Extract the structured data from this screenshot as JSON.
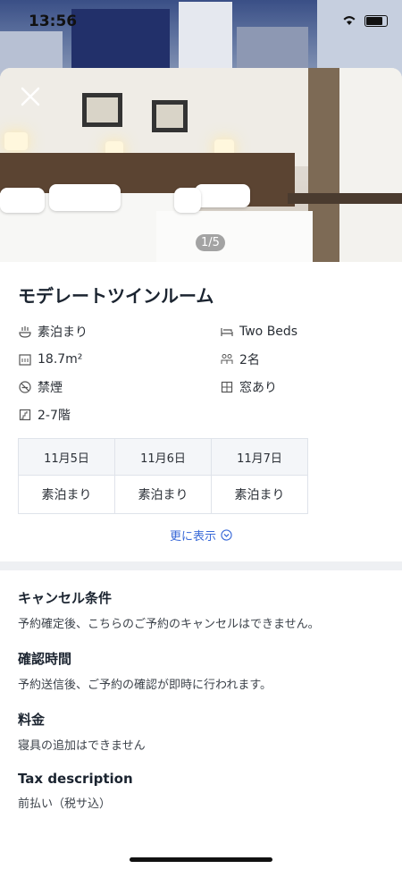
{
  "status_bar": {
    "time": "13:56"
  },
  "photo": {
    "counter": "1/5"
  },
  "room": {
    "title": "モデレートツインルーム",
    "amenities": [
      {
        "icon": "meal-icon",
        "label": "素泊まり"
      },
      {
        "icon": "bed-icon",
        "label": "Two Beds"
      },
      {
        "icon": "area-icon",
        "label": "18.7m²"
      },
      {
        "icon": "guests-icon",
        "label": "2名"
      },
      {
        "icon": "no-smoking-icon",
        "label": "禁煙"
      },
      {
        "icon": "window-icon",
        "label": "窓あり"
      },
      {
        "icon": "floor-icon",
        "label": "2-7階"
      }
    ]
  },
  "table": {
    "dates": [
      "11月5日",
      "11月6日",
      "11月7日"
    ],
    "plans": [
      "素泊まり",
      "素泊まり",
      "素泊まり"
    ]
  },
  "show_more": "更に表示",
  "policies": [
    {
      "title": "キャンセル条件",
      "text": "予約確定後、こちらのご予約のキャンセルはできません。"
    },
    {
      "title": "確認時間",
      "text": "予約送信後、ご予約の確認が即時に行われます。"
    },
    {
      "title": "料金",
      "text": "寝具の追加はできません"
    },
    {
      "title": "Tax description",
      "text": "前払い（税サ込）"
    }
  ],
  "colors": {
    "link": "#3a6ad8",
    "text": "#1b2430",
    "table_header": "#f4f6f9"
  }
}
